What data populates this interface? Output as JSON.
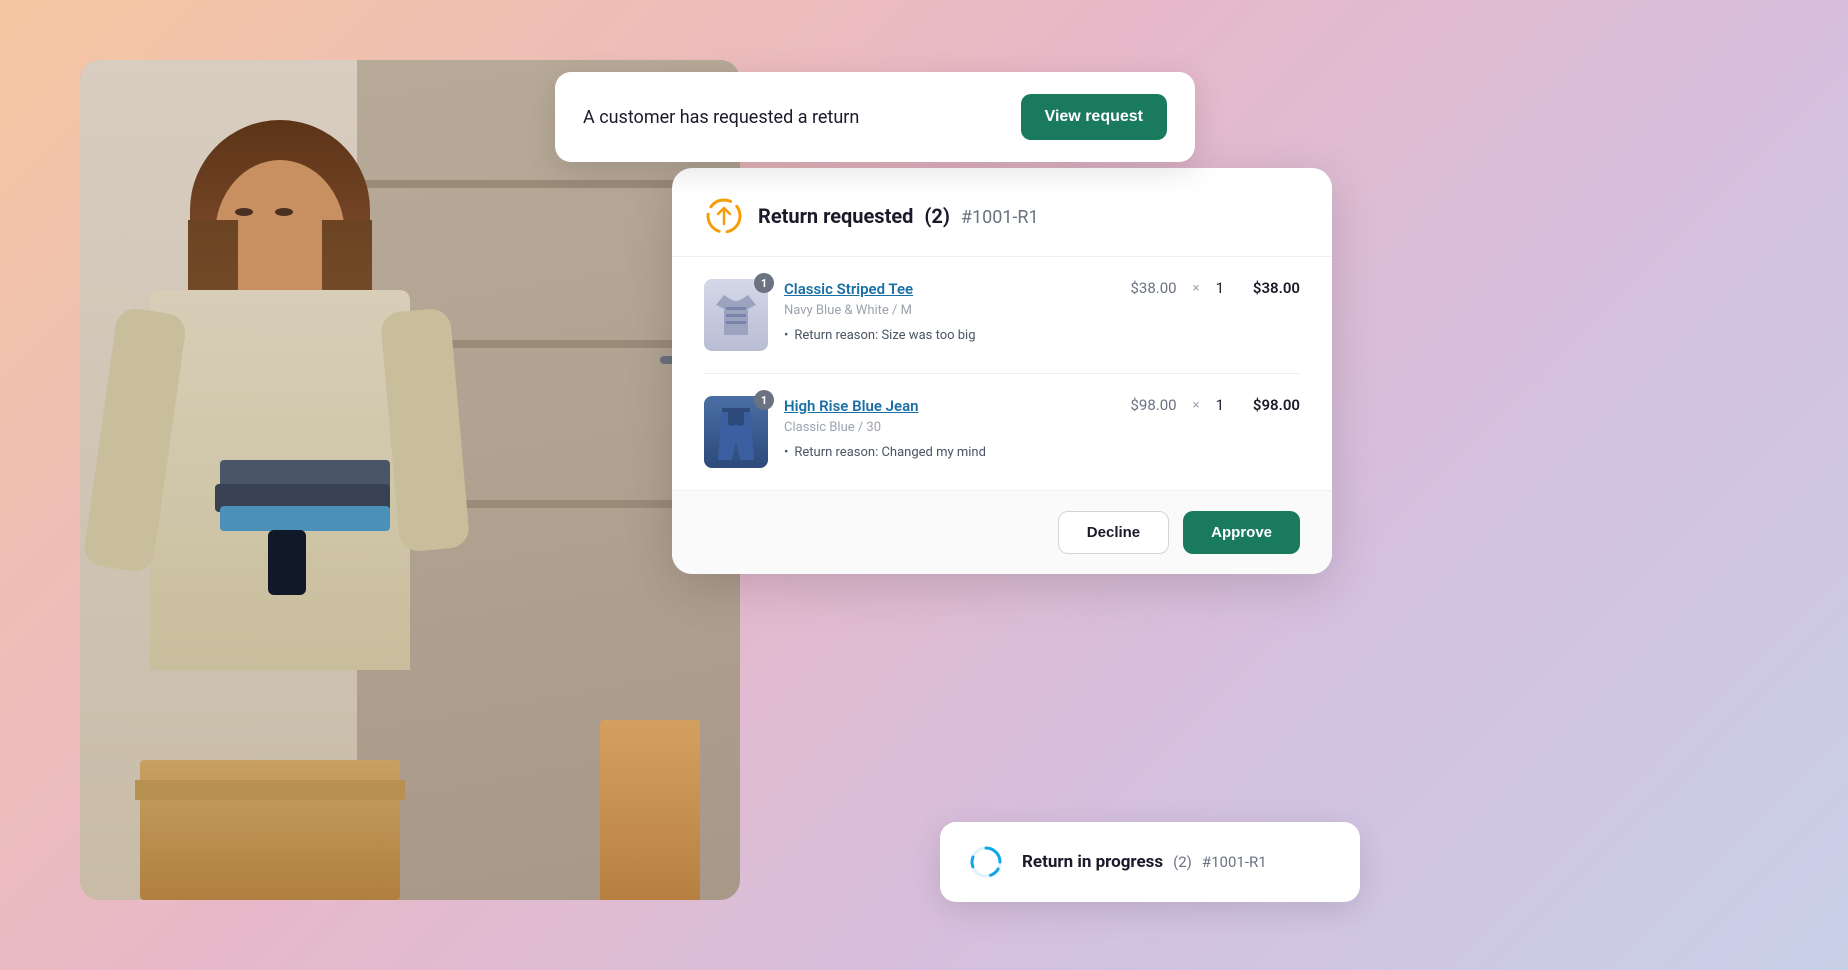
{
  "background": {
    "gradient": "135deg, #f5c6a0 0%, #e8b8c8 40%, #d4c0e0 70%, #c8d0e8 100%"
  },
  "notification": {
    "text": "A customer has requested a return",
    "button_label": "View request"
  },
  "return_card": {
    "title": "Return requested",
    "count": "(2)",
    "order_id": "#1001-R1",
    "items": [
      {
        "name": "Classic Striped Tee",
        "variant": "Navy Blue & White / M",
        "reason": "Return reason: Size was too big",
        "unit_price": "$38.00",
        "quantity": "1",
        "total_price": "$38.00",
        "badge": "1",
        "type": "tee"
      },
      {
        "name": "High Rise Blue Jean",
        "variant": "Classic Blue / 30",
        "reason": "Return reason: Changed my mind",
        "unit_price": "$98.00",
        "quantity": "1",
        "total_price": "$98.00",
        "badge": "1",
        "type": "jean"
      }
    ],
    "decline_label": "Decline",
    "approve_label": "Approve"
  },
  "progress_card": {
    "text": "Return in progress",
    "count": "(2)",
    "order_id": "#1001-R1"
  }
}
